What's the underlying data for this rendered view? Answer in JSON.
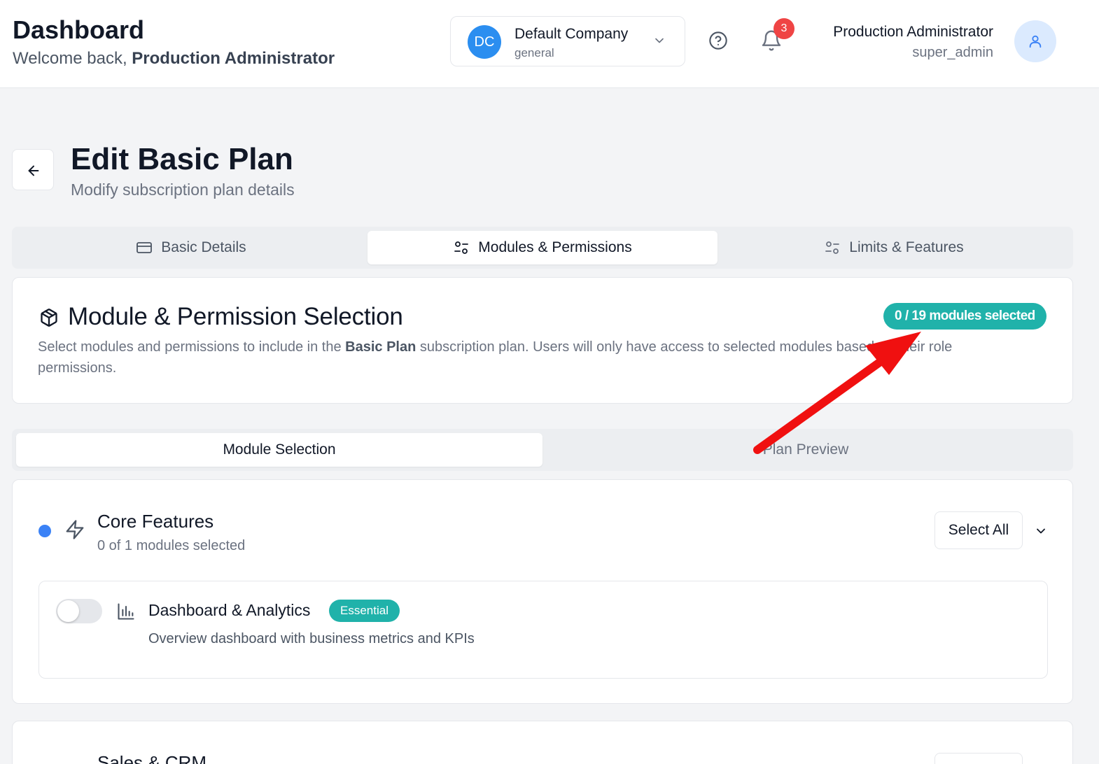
{
  "header": {
    "title": "Dashboard",
    "welcome_prefix": "Welcome back, ",
    "welcome_name": "Production Administrator",
    "company": {
      "initials": "DC",
      "name": "Default Company",
      "sub": "general"
    },
    "notifications_count": "3",
    "user": {
      "name": "Production Administrator",
      "role": "super_admin"
    }
  },
  "page": {
    "title": "Edit Basic Plan",
    "subtitle": "Modify subscription plan details"
  },
  "tabs": [
    {
      "label": "Basic Details",
      "active": false
    },
    {
      "label": "Modules & Permissions",
      "active": true
    },
    {
      "label": "Limits & Features",
      "active": false
    }
  ],
  "selection": {
    "title": "Module & Permission Selection",
    "count_badge": "0 / 19 modules selected",
    "desc_prefix": "Select modules and permissions to include in the ",
    "desc_plan": "Basic Plan",
    "desc_suffix": " subscription plan. Users will only have access to selected modules based on their role permissions."
  },
  "subtabs": [
    {
      "label": "Module Selection",
      "active": true
    },
    {
      "label": "Plan Preview",
      "active": false
    }
  ],
  "categories": [
    {
      "title": "Core Features",
      "subtitle": "0 of 1 modules selected",
      "select_all_label": "Select All",
      "modules": [
        {
          "name": "Dashboard & Analytics",
          "badge": "Essential",
          "description": "Overview dashboard with business metrics and KPIs",
          "enabled": false
        }
      ]
    },
    {
      "title": "Sales & CRM"
    }
  ],
  "colors": {
    "accent_teal": "#20b2aa",
    "company_avatar": "#2b8ef0",
    "notification_red": "#ef4444",
    "category_dot": "#3b82f6",
    "annotation_arrow": "#f01010"
  }
}
